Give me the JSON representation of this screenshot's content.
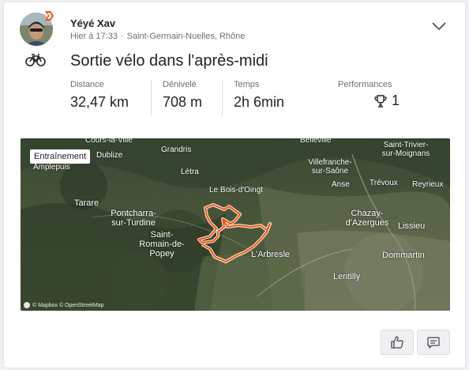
{
  "athlete": {
    "name": "Yéyé Xav",
    "time": "Hier à 17:33",
    "location": "Saint-Germain-Nuelles, Rhône"
  },
  "activity": {
    "sport_icon": "bike-icon",
    "title": "Sortie vélo dans l'après-midi",
    "stats": [
      {
        "label": "Distance",
        "value": "32,47 km"
      },
      {
        "label": "Dénivelé",
        "value": "708 m"
      },
      {
        "label": "Temps",
        "value": "2h 6min"
      }
    ],
    "performances": {
      "label": "Performances",
      "value": "1",
      "icon": "trophy-icon"
    }
  },
  "map": {
    "tag": "Entraînement",
    "attribution": "© Mapbox © OpenStreetMap",
    "places": [
      {
        "text": "Cours-la-Ville"
      },
      {
        "text": "Dublize"
      },
      {
        "text": "Amplepuis"
      },
      {
        "text": "Grandris"
      },
      {
        "text": "Létra"
      },
      {
        "text": "Le Bois-d'Oingt"
      },
      {
        "text": "Belleville"
      },
      {
        "text": "Saint-Trivier-sur-Moignans"
      },
      {
        "text": "Villefranche-sur-Saône"
      },
      {
        "text": "Anse"
      },
      {
        "text": "Trévoux"
      },
      {
        "text": "Reyrieux"
      },
      {
        "text": "Tarare"
      },
      {
        "text": "Pontcharra-sur-Turdine"
      },
      {
        "text": "Saint-Romain-de-Popey"
      },
      {
        "text": "Chazay-d'Azergues"
      },
      {
        "text": "Lissieu"
      },
      {
        "text": "L'Arbresle"
      },
      {
        "text": "Dommartin"
      },
      {
        "text": "Lentilly"
      }
    ],
    "route_color": "#fc5200"
  },
  "actions": {
    "kudos_icon": "thumbs-up-icon",
    "comment_icon": "comment-icon"
  }
}
